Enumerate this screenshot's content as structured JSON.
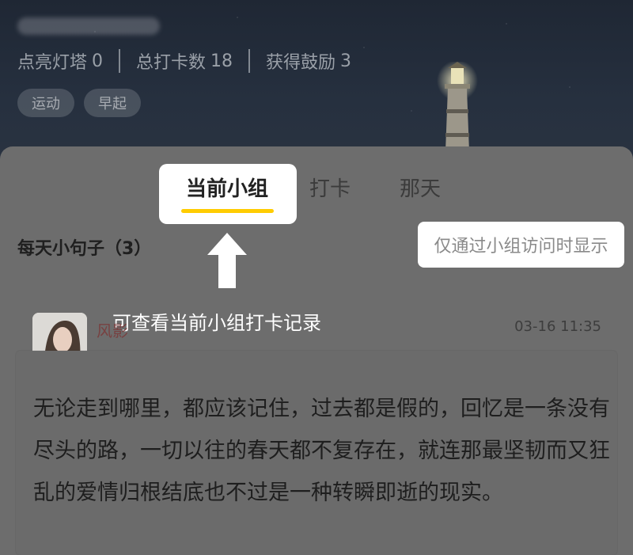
{
  "header": {
    "stats": [
      {
        "label": "点亮灯塔",
        "value": "0"
      },
      {
        "label": "总打卡数",
        "value": "18"
      },
      {
        "label": "获得鼓励",
        "value": "3"
      }
    ],
    "tags": [
      "运动",
      "早起"
    ]
  },
  "tabs": [
    {
      "label": "当前小组",
      "active": true
    },
    {
      "label": "打卡",
      "active": false
    },
    {
      "label": "那天",
      "active": false
    }
  ],
  "accent_color": "#ffcc00",
  "group": {
    "title": "每天小句子（3）",
    "visibility_note": "仅通过小组访问时显示"
  },
  "annotation": {
    "callout": "可查看当前小组打卡记录"
  },
  "post": {
    "username": "风影",
    "timestamp": "03-16 11:35",
    "content": "无论走到哪里，都应该记住，过去都是假的，回忆是一条没有尽头的路，一切以往的春天都不复存在，就连那最坚韧而又狂乱的爱情归根结底也不过是一种转瞬即逝的现实。"
  }
}
